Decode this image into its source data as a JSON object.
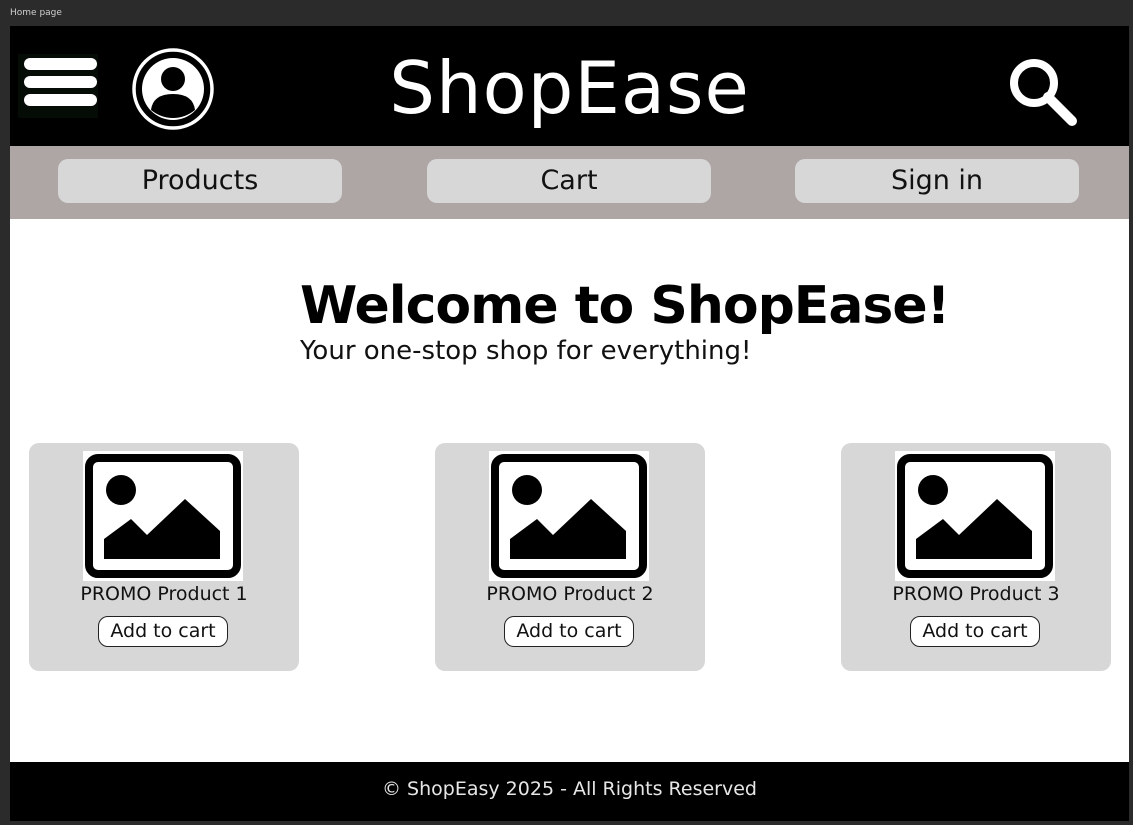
{
  "window": {
    "frame_label": "Home page"
  },
  "header": {
    "brand": "ShopEase",
    "menu_icon": "hamburger-menu-icon",
    "account_icon": "user-account-icon",
    "search_icon": "search-icon"
  },
  "nav": {
    "items": [
      {
        "label": "Products"
      },
      {
        "label": "Cart"
      },
      {
        "label": "Sign in"
      }
    ]
  },
  "welcome": {
    "title": "Welcome to ShopEase!",
    "subtitle": "Your one-stop shop for everything!"
  },
  "products": [
    {
      "name": "PROMO Product 1",
      "button": "Add to cart",
      "image_icon": "image-placeholder-icon"
    },
    {
      "name": "PROMO Product 2",
      "button": "Add to cart",
      "image_icon": "image-placeholder-icon"
    },
    {
      "name": "PROMO Product 3",
      "button": "Add to cart",
      "image_icon": "image-placeholder-icon"
    }
  ],
  "footer": {
    "text": "© ShopEasy 2025 - All Rights Reserved"
  },
  "colors": {
    "header_bg": "#000000",
    "nav_bg": "#ada6a5",
    "nav_button_bg": "#d8d7d8",
    "card_bg": "#d8d7d8",
    "page_bg": "#ffffff",
    "footer_bg": "#000000"
  }
}
